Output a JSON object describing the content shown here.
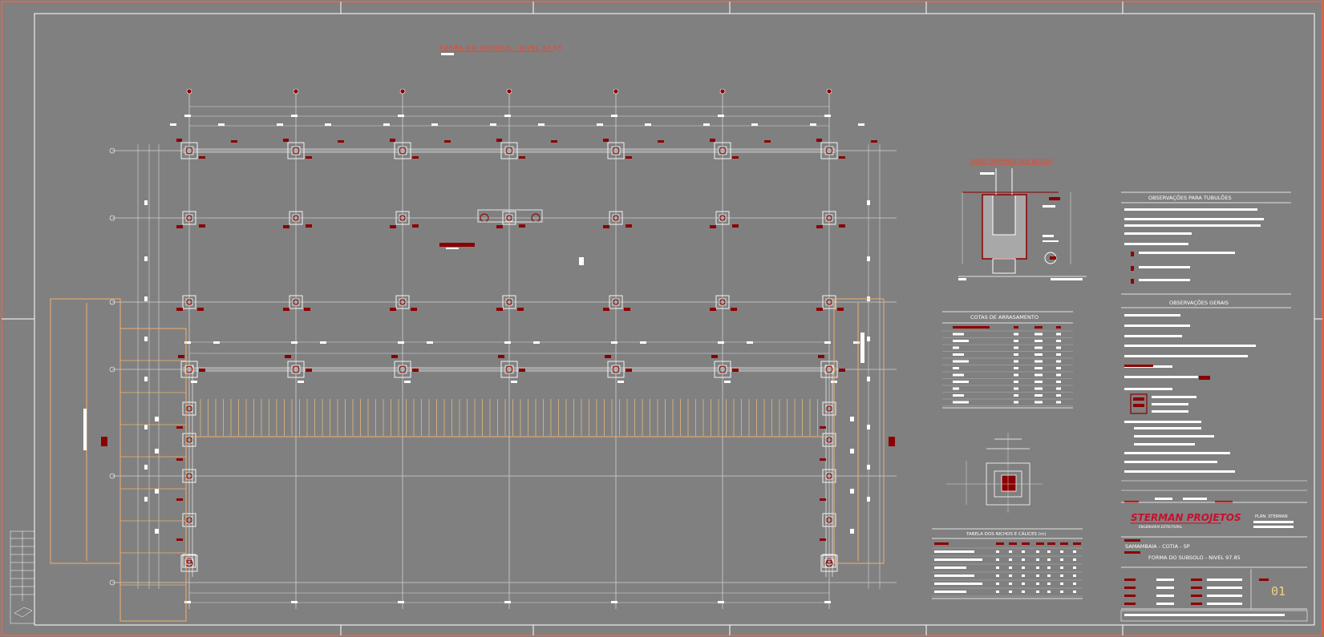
{
  "drawing": {
    "title": "FORMA DO SUBSOLO - NIVEL 97,85",
    "section_title": "CORTE GENÉRICO DOS BLOCOS"
  },
  "notes": {
    "tubuloes_title": "OBSERVAÇÕES PARA TUBULÕES",
    "general_title": "OBSERVAÇÕES GERAIS"
  },
  "tables": {
    "cotas_title": "COTAS DE ARRASAMENTO",
    "nichos_title": "TABELA DOS NICHOS E CÁLICES (m)"
  },
  "title_block": {
    "company": "STERMAN PROJETOS",
    "company_sub": "ENGENHARIA ESTRUTURAL",
    "plan_label": "PLÁN. STERMAN",
    "location": "SAMAMBAIA - COTIA - SP",
    "drawing_name": "FORMA DO SUBSOLO - NIVEL 97.85",
    "sheet_number": "01"
  },
  "colors": {
    "background": "#808080",
    "lines": "#e6e6e6",
    "accent_red": "#8b0000",
    "title_red": "#ff3b1f",
    "border": "#ff5a3c",
    "orange": "#f0b070"
  }
}
